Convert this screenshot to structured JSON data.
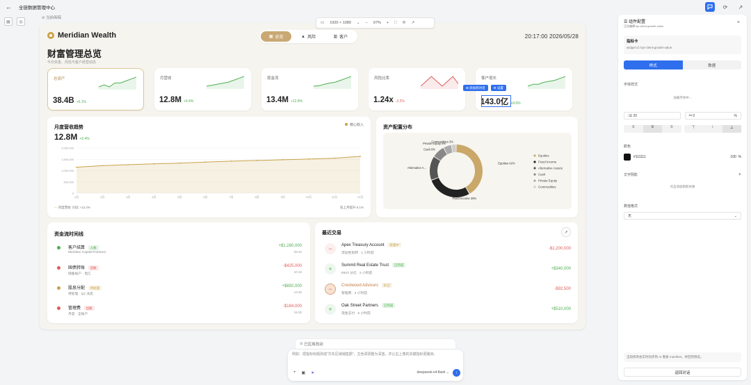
{
  "app": {
    "title": "全链数据管理中心",
    "tag": "当前画稿"
  },
  "viewport": {
    "size": "1920 × 1080",
    "zoom": "97%"
  },
  "brand": {
    "name": "Meridian Wealth"
  },
  "nav": {
    "tabs": [
      {
        "label": "总览",
        "icon": "grid-icon"
      },
      {
        "label": "风险",
        "icon": "warning-icon"
      },
      {
        "label": "客户",
        "icon": "users-icon"
      }
    ],
    "active": 0
  },
  "clock": "20:17:00  2026/05/28",
  "page": {
    "title": "财富管理总览",
    "subtitle": "今日资金、风险与客户经营动态"
  },
  "kpis": [
    {
      "label": "总资产",
      "value": "38.4B",
      "change": "+6.1%",
      "trend": "up",
      "spark": [
        10,
        11,
        10,
        12,
        12,
        13,
        14,
        15
      ],
      "color": "#4caf50"
    },
    {
      "label": "月营收",
      "value": "12.8M",
      "change": "+9.4%",
      "trend": "up",
      "spark": [
        10,
        10.5,
        11,
        11.5,
        12,
        13,
        14,
        15
      ],
      "color": "#4caf50"
    },
    {
      "label": "现金流",
      "value": "13.4M",
      "change": "+12.8%",
      "trend": "up",
      "spark": [
        10,
        10.2,
        11,
        11.6,
        12,
        13,
        14,
        15
      ],
      "color": "#4caf50"
    },
    {
      "label": "风险比率",
      "value": "1.24x",
      "change": "-3.2%",
      "trend": "down",
      "spark": [
        12,
        13,
        14,
        13,
        12,
        13,
        14,
        12.5
      ],
      "color": "#e05a5a"
    },
    {
      "label": "客户增长",
      "value": "143.0亿",
      "change": "+8.6%",
      "trend": "up",
      "spark": [
        10,
        11,
        11,
        12,
        12.5,
        13,
        14,
        15
      ],
      "color": "#4caf50"
    }
  ],
  "floating_buttons": {
    "add": "添加到对话",
    "settings": "设置"
  },
  "trend": {
    "title": "月度营收趋势",
    "value": "12.8M",
    "change": "+9.4%",
    "legend": "核心收入",
    "footer_left": "月度营收",
    "footer_mid": "同比 +12.2%",
    "footer_right": "较上月提升 6.1%"
  },
  "chart_data": [
    {
      "type": "line",
      "title": "月度营收趋势",
      "categories": [
        "1月",
        "2月",
        "3月",
        "4月",
        "5月",
        "6月",
        "7月",
        "8月",
        "9月",
        "10月",
        "11月",
        "12月"
      ],
      "series": [
        {
          "name": "核心收入",
          "values": [
            1150000,
            1220000,
            1260000,
            1300000,
            1330000,
            1380000,
            1420000,
            1450000,
            1480000,
            1510000,
            1550000,
            1630000
          ]
        }
      ],
      "yticks": [
        "2,000,000",
        "1,500,000",
        "1,000,000",
        "500,000",
        "0"
      ],
      "ylim": [
        0,
        2000000
      ]
    },
    {
      "type": "pie",
      "title": "资产配置分布",
      "labels": [
        "Equities",
        "Fixed Income",
        "Alternative Assets",
        "Cash",
        "Private Equity",
        "Commodities"
      ],
      "values": [
        42,
        28,
        15,
        8,
        5,
        3
      ],
      "data_labels": [
        "Equities 42%",
        "Fixed Income 28%",
        "Alternative A...",
        "Cash 8%",
        "Private Equity 5%",
        "Commodities 3%"
      ],
      "colors": [
        "#c9a86a",
        "#222222",
        "#555555",
        "#888888",
        "#aaaaaa",
        "#cccccc"
      ]
    }
  ],
  "flow": {
    "title": "资金流时间线",
    "items": [
      {
        "title": "客户结算",
        "badge": "入账",
        "badge_color": "#4caf50",
        "sub": "Meridian Capital Partners",
        "amount": "+$1,280,000",
        "time": "09:42",
        "dot": "#4caf50",
        "positive": true
      },
      {
        "title": "国债转账",
        "badge": "出账",
        "badge_color": "#e05a5a",
        "sub": "储备账户 · 电汇",
        "amount": "-$425,000",
        "time": "10:15",
        "dot": "#e05a5a",
        "positive": false
      },
      {
        "title": "股息分配",
        "badge": "待处理",
        "badge_color": "#c9a24a",
        "sub": "待处理 · Q2 派息",
        "amount": "+$892,000",
        "time": "14:30",
        "dot": "#c9a24a",
        "positive": true
      },
      {
        "title": "管理费",
        "badge": "出账",
        "badge_color": "#e05a5a",
        "sub": "月度 · 全账户",
        "amount": "-$184,000",
        "time": "15:30",
        "dot": "#e05a5a",
        "positive": false
      }
    ]
  },
  "trades": {
    "title": "最近交易",
    "items": [
      {
        "name": "Apex Treasury Account",
        "badge": "处理中",
        "badge_color": "#c9a24a",
        "sub": "流动性划转 · 1 小时前",
        "amount": "-$1,200,000",
        "positive": false,
        "sign": "−",
        "icon": "minus-icon"
      },
      {
        "name": "Summit Real Estate Trust",
        "badge": "已完成",
        "badge_color": "#4caf50",
        "sub": "REIT 分红 · 2 小时前",
        "amount": "+$340,000",
        "positive": true,
        "sign": "+",
        "icon": "plus-icon"
      },
      {
        "name": "Crestwood Advisors",
        "badge": "标记",
        "badge_color": "#c9a24a",
        "sub": "管理费 · 3 小时前",
        "amount": "-$92,500",
        "positive": false,
        "sign": "−",
        "icon": "minus-icon",
        "highlight": true
      },
      {
        "name": "Oak Street Partners",
        "badge": "已完成",
        "badge_color": "#4caf50",
        "sub": "现金支付 · 5 小时前",
        "amount": "+$510,000",
        "positive": true,
        "sign": "+",
        "icon": "plus-icon"
      }
    ]
  },
  "right_panel": {
    "title": "组件配置",
    "subtitle": "正在编辑 kpi-client-growth-value",
    "widget_name": "指标卡",
    "widget_id": "widget id: kpi-client-growth-value",
    "tabs": [
      "样式",
      "数据"
    ],
    "font_section": "字体样式",
    "font_placeholder": "加载字体中...",
    "size": "20",
    "spacing": "0",
    "spacing_unit": "%",
    "color_section": "颜色",
    "color_value": "#111111",
    "opacity": "100",
    "opacity_unit": "%",
    "shadow_section": "文字阴影",
    "shadow_hint": "点击添加阴影效果",
    "format_section": "数值格式",
    "format_value": "无",
    "footer_note": "当前修改会实时同步到 AI 看板 manifest，并回到预览。",
    "back_button": "返回对话"
  },
  "chat": {
    "note": "已应用改动",
    "placeholder": "例如：把指标标题改成\"华东区域销售额\"，主色调调整为深蓝，并让右上角的关键指标更醒目。",
    "model": "deepseek-v4-flash"
  }
}
